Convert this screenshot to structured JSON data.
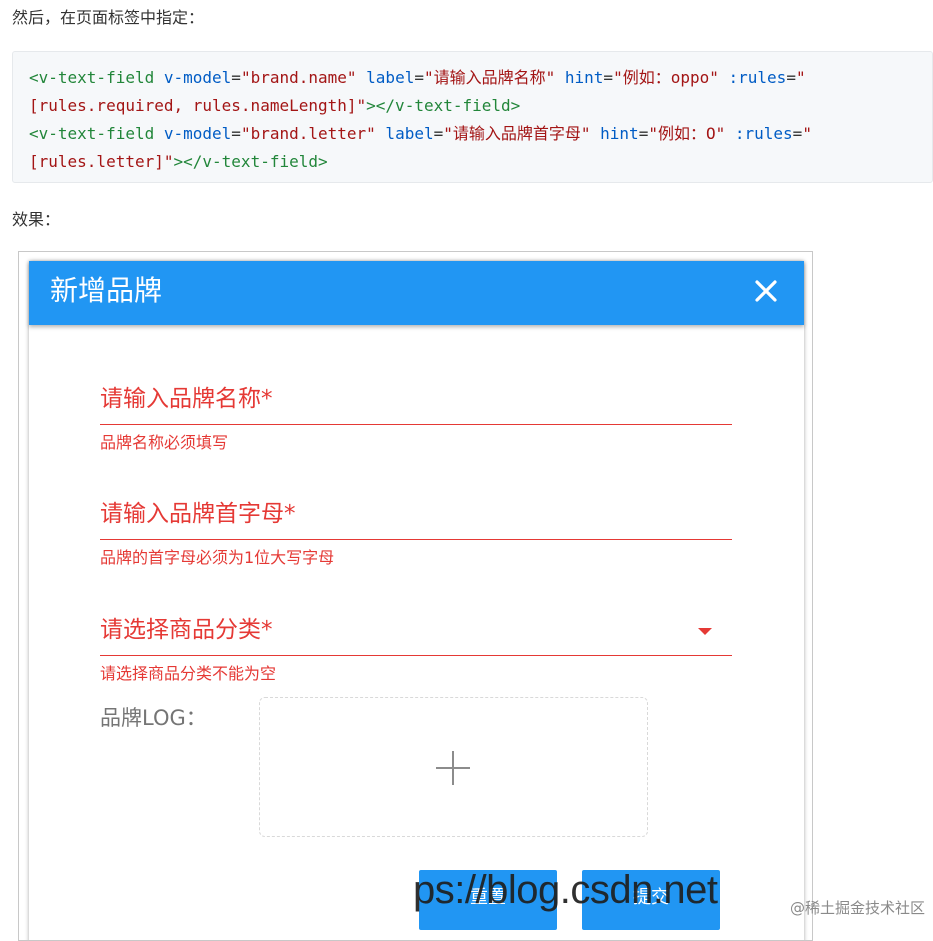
{
  "intro_text": "然后，在页面标签中指定：",
  "code_lines": [
    [
      {
        "t": "<v-text-field",
        "c": "tag"
      },
      {
        "t": " v-model",
        "c": "attr"
      },
      {
        "t": "=",
        "c": "punct"
      },
      {
        "t": "\"brand.name\"",
        "c": "str"
      },
      {
        "t": " label",
        "c": "attr"
      },
      {
        "t": "=",
        "c": "punct"
      },
      {
        "t": "\"请输入品牌名称\"",
        "c": "str"
      },
      {
        "t": " hint",
        "c": "attr"
      },
      {
        "t": "=",
        "c": "punct"
      },
      {
        "t": "\"例如：oppo\"",
        "c": "str"
      },
      {
        "t": " :rules",
        "c": "attr"
      },
      {
        "t": "=",
        "c": "punct"
      },
      {
        "t": "\"",
        "c": "str"
      }
    ],
    [
      {
        "t": "[rules.required, rules.nameLength]\"",
        "c": "str"
      },
      {
        "t": "></v-text-field>",
        "c": "tag"
      }
    ],
    [
      {
        "t": "<v-text-field",
        "c": "tag"
      },
      {
        "t": " v-model",
        "c": "attr"
      },
      {
        "t": "=",
        "c": "punct"
      },
      {
        "t": "\"brand.letter\"",
        "c": "str"
      },
      {
        "t": " label",
        "c": "attr"
      },
      {
        "t": "=",
        "c": "punct"
      },
      {
        "t": "\"请输入品牌首字母\"",
        "c": "str"
      },
      {
        "t": " hint",
        "c": "attr"
      },
      {
        "t": "=",
        "c": "punct"
      },
      {
        "t": "\"例如：O\"",
        "c": "str"
      },
      {
        "t": " :rules",
        "c": "attr"
      },
      {
        "t": "=",
        "c": "punct"
      },
      {
        "t": "\"",
        "c": "str"
      }
    ],
    [
      {
        "t": "[rules.letter]\"",
        "c": "str"
      },
      {
        "t": "></v-text-field>",
        "c": "tag"
      }
    ]
  ],
  "effect_label": "效果：",
  "dialog": {
    "title": "新增品牌",
    "close_icon": "close-icon",
    "fields": [
      {
        "label": "请输入品牌名称*",
        "error": "品牌名称必须填写"
      },
      {
        "label": "请输入品牌首字母*",
        "error": "品牌的首字母必须为1位大写字母"
      },
      {
        "label": "请选择商品分类*",
        "error": "请选择商品分类不能为空"
      }
    ],
    "logo_label": "品牌LOG：",
    "upload_icon": "plus-icon",
    "buttons": {
      "reset": "重置",
      "submit": "提交"
    }
  },
  "watermark_text": "ps://blog.csdn.net",
  "credit_text": "@稀土掘金技术社区",
  "colors": {
    "header": "#2196f3",
    "error": "#e53935",
    "tag": "#22863a",
    "attr": "#005cc5",
    "string": "#a31515"
  }
}
